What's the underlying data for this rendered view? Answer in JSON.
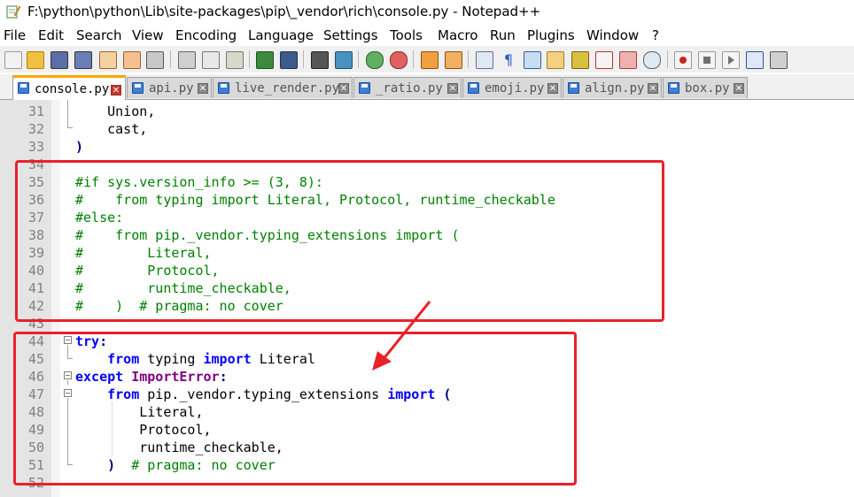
{
  "window": {
    "title": "F:\\python\\python\\Lib\\site-packages\\pip\\_vendor\\rich\\console.py - Notepad++"
  },
  "menu": [
    "File",
    "Edit",
    "Search",
    "View",
    "Encoding",
    "Language",
    "Settings",
    "Tools",
    "Macro",
    "Run",
    "Plugins",
    "Window",
    "?"
  ],
  "tabs": [
    {
      "label": "console.py",
      "active": true
    },
    {
      "label": "api.py",
      "active": false
    },
    {
      "label": "live_render.py",
      "active": false
    },
    {
      "label": "_ratio.py",
      "active": false
    },
    {
      "label": "emoji.py",
      "active": false
    },
    {
      "label": "align.py",
      "active": false
    },
    {
      "label": "box.py",
      "active": false
    }
  ],
  "lines": [
    {
      "n": "31",
      "text": "    Union,"
    },
    {
      "n": "32",
      "text": "    cast,"
    },
    {
      "n": "33",
      "text": ")"
    },
    {
      "n": "34",
      "text": ""
    },
    {
      "n": "35",
      "text": "#if sys.version_info >= (3, 8):"
    },
    {
      "n": "36",
      "text": "#    from typing import Literal, Protocol, runtime_checkable"
    },
    {
      "n": "37",
      "text": "#else:"
    },
    {
      "n": "38",
      "text": "#    from pip._vendor.typing_extensions import ("
    },
    {
      "n": "39",
      "text": "#        Literal,"
    },
    {
      "n": "40",
      "text": "#        Protocol,"
    },
    {
      "n": "41",
      "text": "#        runtime_checkable,"
    },
    {
      "n": "42",
      "text": "#    )  # pragma: no cover"
    },
    {
      "n": "43",
      "text": ""
    },
    {
      "n": "44",
      "kw": "try",
      "rest": ":"
    },
    {
      "n": "45",
      "indent": "    ",
      "kw": "from",
      "mid": " typing ",
      "kw2": "import",
      "rest": " Literal"
    },
    {
      "n": "46",
      "kw": "except",
      "cls": " ImportError",
      "rest": ":"
    },
    {
      "n": "47",
      "indent": "    ",
      "kw": "from",
      "mid": " pip._vendor.typing_extensions ",
      "kw2": "import",
      "rest": " ("
    },
    {
      "n": "48",
      "text": "        Literal,"
    },
    {
      "n": "49",
      "text": "        Protocol,"
    },
    {
      "n": "50",
      "text": "        runtime_checkable,"
    },
    {
      "n": "51",
      "indent": "    ",
      "paren": ")",
      "comment": "  # pragma: no cover"
    },
    {
      "n": "52",
      "text": ""
    }
  ],
  "colors": {
    "keyword": "#0000ff",
    "comment": "#008000",
    "class": "#800080",
    "annotation": "#e8212a"
  }
}
